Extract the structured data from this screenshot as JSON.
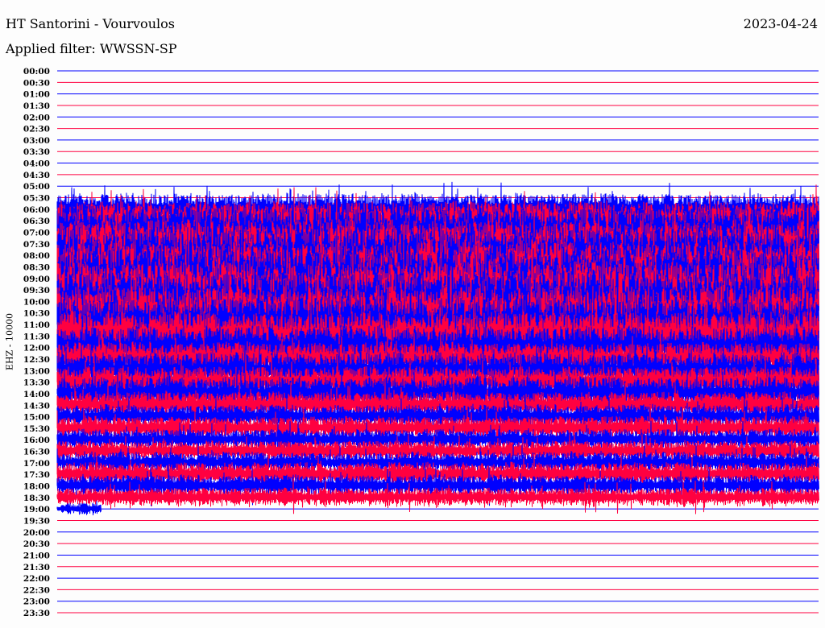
{
  "header": {
    "title": "HT Santorini - Vourvoulos",
    "filter": "Applied filter: WWSSN-SP",
    "date": "2023-04-24"
  },
  "chart_data": {
    "type": "line",
    "title": "HT Santorini - Vourvoulos",
    "subtitle": "Applied filter: WWSSN-SP",
    "ylabel": "EHZ - 10000",
    "colors": {
      "blue": "#0000ff",
      "red": "#ff0040"
    },
    "rows": [
      {
        "label": "00:00",
        "color": "blue",
        "amp": 0
      },
      {
        "label": "00:30",
        "color": "red",
        "amp": 0
      },
      {
        "label": "01:00",
        "color": "blue",
        "amp": 0
      },
      {
        "label": "01:30",
        "color": "red",
        "amp": 0
      },
      {
        "label": "02:00",
        "color": "blue",
        "amp": 0
      },
      {
        "label": "02:30",
        "color": "red",
        "amp": 0
      },
      {
        "label": "03:00",
        "color": "blue",
        "amp": 0
      },
      {
        "label": "03:30",
        "color": "red",
        "amp": 0
      },
      {
        "label": "04:00",
        "color": "blue",
        "amp": 0
      },
      {
        "label": "04:30",
        "color": "red",
        "amp": 0
      },
      {
        "label": "05:00",
        "color": "blue",
        "amp": 0
      },
      {
        "label": "05:30",
        "color": "red",
        "amp": 0
      },
      {
        "label": "06:00",
        "color": "blue",
        "amp": 1.3
      },
      {
        "label": "06:30",
        "color": "red",
        "amp": 1.6
      },
      {
        "label": "07:00",
        "color": "blue",
        "amp": 2.2
      },
      {
        "label": "07:30",
        "color": "red",
        "amp": 2.0
      },
      {
        "label": "08:00",
        "color": "blue",
        "amp": 2.4
      },
      {
        "label": "08:30",
        "color": "red",
        "amp": 2.2
      },
      {
        "label": "09:00",
        "color": "blue",
        "amp": 2.6
      },
      {
        "label": "09:30",
        "color": "red",
        "amp": 2.4
      },
      {
        "label": "10:00",
        "color": "blue",
        "amp": 2.6
      },
      {
        "label": "10:30",
        "color": "red",
        "amp": 2.3
      },
      {
        "label": "11:00",
        "color": "blue",
        "amp": 2.4
      },
      {
        "label": "11:30",
        "color": "red",
        "amp": 2.0
      },
      {
        "label": "12:00",
        "color": "blue",
        "amp": 1.8
      },
      {
        "label": "12:30",
        "color": "red",
        "amp": 1.4
      },
      {
        "label": "13:00",
        "color": "blue",
        "amp": 1.5
      },
      {
        "label": "13:30",
        "color": "red",
        "amp": 1.3
      },
      {
        "label": "14:00",
        "color": "blue",
        "amp": 1.4
      },
      {
        "label": "14:30",
        "color": "red",
        "amp": 1.1
      },
      {
        "label": "15:00",
        "color": "blue",
        "amp": 1.0
      },
      {
        "label": "15:30",
        "color": "red",
        "amp": 1.0
      },
      {
        "label": "16:00",
        "color": "blue",
        "amp": 0.9
      },
      {
        "label": "16:30",
        "color": "red",
        "amp": 0.9
      },
      {
        "label": "17:00",
        "color": "blue",
        "amp": 0.9
      },
      {
        "label": "17:30",
        "color": "red",
        "amp": 1.0
      },
      {
        "label": "18:00",
        "color": "blue",
        "amp": 0.9
      },
      {
        "label": "18:30",
        "color": "red",
        "amp": 0.8
      },
      {
        "label": "19:00",
        "color": "blue",
        "amp": 0.5,
        "end_fraction": 0.058
      },
      {
        "label": "19:30",
        "color": "red",
        "amp": 0
      },
      {
        "label": "20:00",
        "color": "blue",
        "amp": 0
      },
      {
        "label": "20:30",
        "color": "red",
        "amp": 0
      },
      {
        "label": "21:00",
        "color": "blue",
        "amp": 0
      },
      {
        "label": "21:30",
        "color": "red",
        "amp": 0
      },
      {
        "label": "22:00",
        "color": "blue",
        "amp": 0
      },
      {
        "label": "22:30",
        "color": "red",
        "amp": 0
      },
      {
        "label": "23:00",
        "color": "blue",
        "amp": 0
      },
      {
        "label": "23:30",
        "color": "red",
        "amp": 0
      }
    ],
    "row_minutes": 30
  }
}
